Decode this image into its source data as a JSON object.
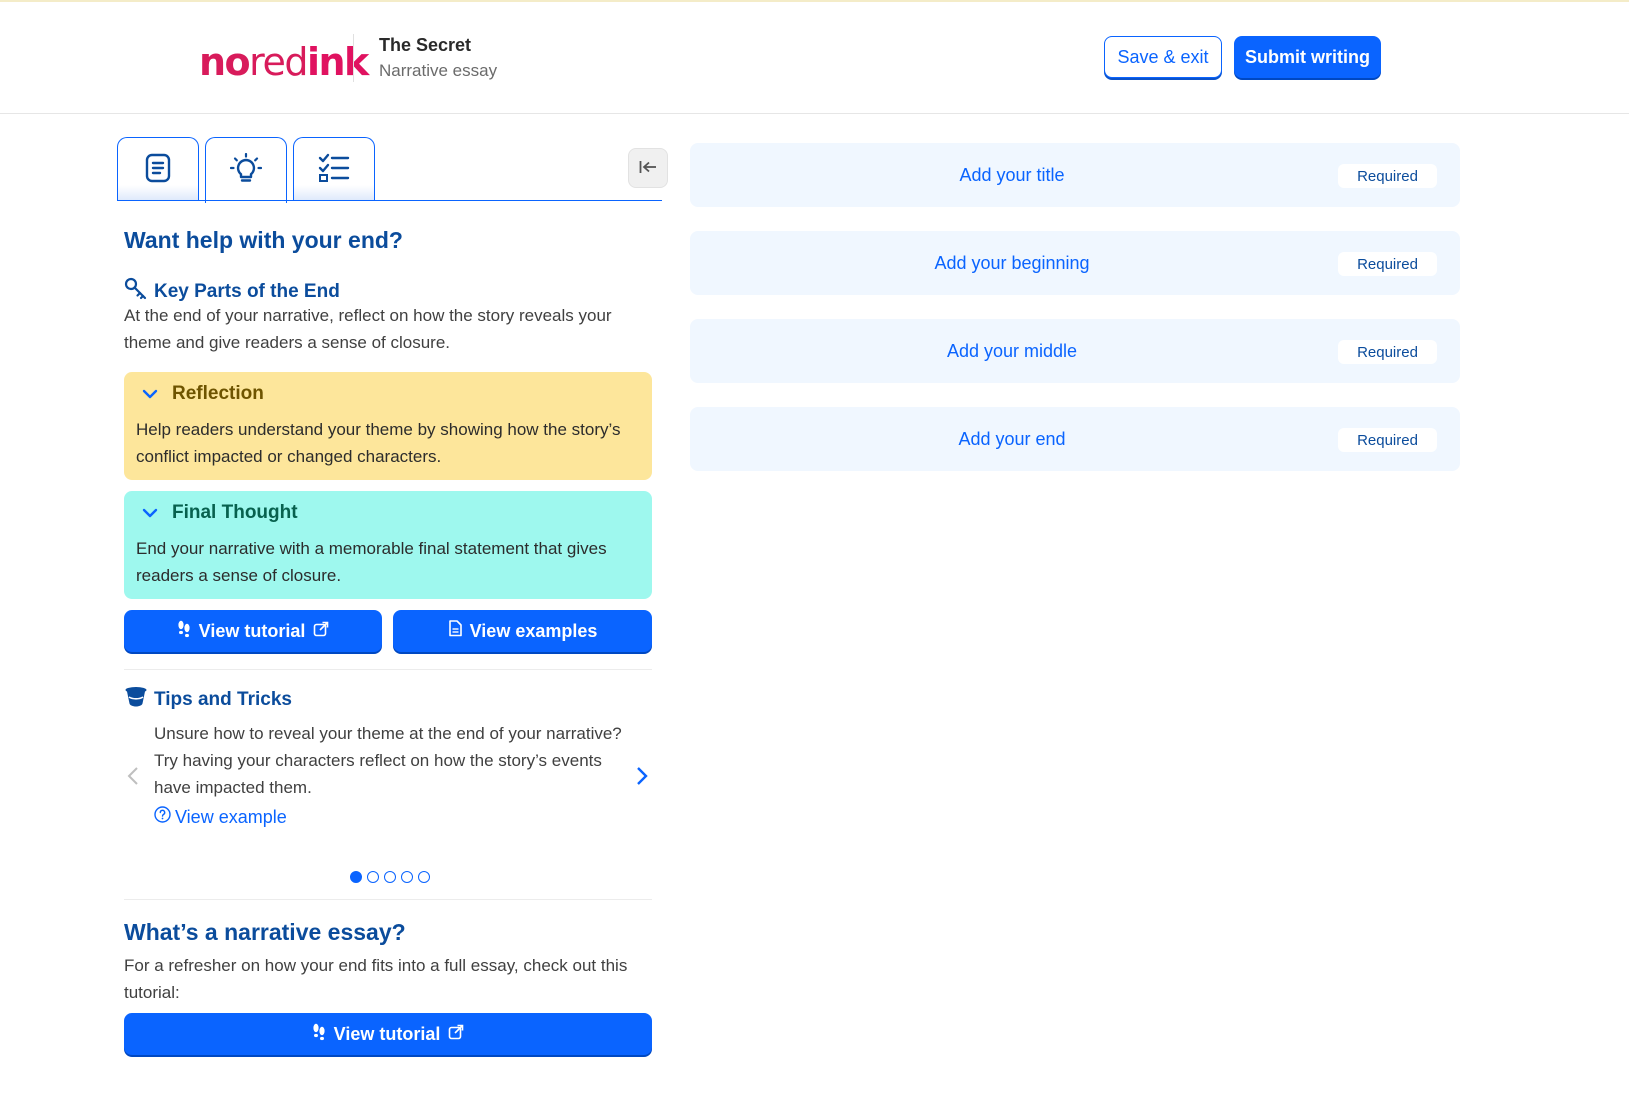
{
  "header": {
    "logo": {
      "part1": "no",
      "part2": "red",
      "part3": "ink"
    },
    "title": "The Secret",
    "subtitle": "Narrative essay",
    "save_exit_label": "Save & exit",
    "submit_label": "Submit writing"
  },
  "tabs": [
    {
      "icon": "document-icon",
      "active": false
    },
    {
      "icon": "lightbulb-icon",
      "active": true
    },
    {
      "icon": "checklist-icon",
      "active": false
    }
  ],
  "sidebar": {
    "heading": "Want help with your end?",
    "key_parts": {
      "title": "Key Parts of the End",
      "text": "At the end of your narrative, reflect on how the story reveals your theme and give readers a sense of closure."
    },
    "cards": [
      {
        "title": "Reflection",
        "text": "Help readers understand your theme by showing how the story’s conflict impacted or changed characters.",
        "color": "#fde69b"
      },
      {
        "title": "Final Thought",
        "text": "End your narrative with a memorable final statement that gives readers a sense of closure.",
        "color": "#9ef8ee"
      }
    ],
    "view_tutorial_label": "View tutorial",
    "view_examples_label": "View examples",
    "tips": {
      "title": "Tips and Tricks",
      "text": "Unsure how to reveal your theme at the end of your narrative? Try having your characters reflect on how the story’s events have impacted them.",
      "view_example_label": "View example",
      "page_count": 5,
      "current_page": 1
    },
    "narrative": {
      "heading": "What’s a narrative essay?",
      "text": "For a refresher on how your end fits into a full essay, check out this tutorial:",
      "tutorial_label": "View tutorial"
    }
  },
  "sections": [
    {
      "label": "Add your title",
      "badge": "Required"
    },
    {
      "label": "Add your beginning",
      "badge": "Required"
    },
    {
      "label": "Add your middle",
      "badge": "Required"
    },
    {
      "label": "Add your end",
      "badge": "Required"
    }
  ],
  "colors": {
    "accent": "#0a64ff",
    "heading": "#0b4c9c",
    "brand": "#d81b5b"
  }
}
